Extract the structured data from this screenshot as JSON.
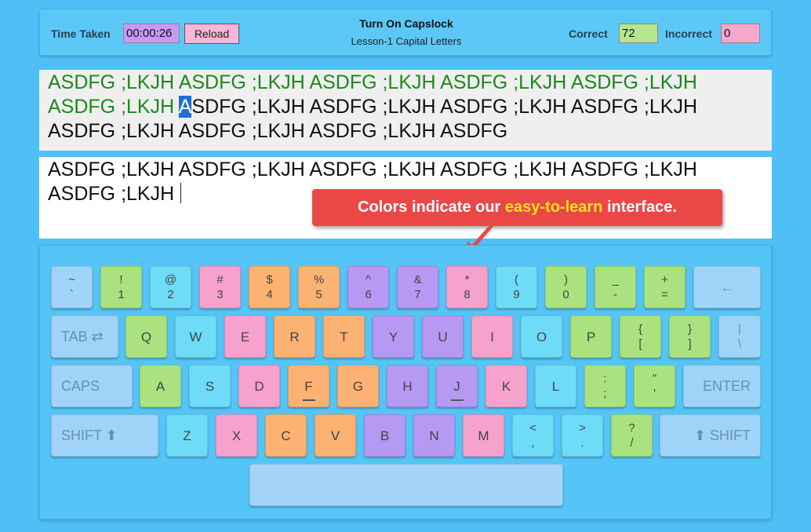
{
  "header": {
    "time_label": "Time Taken",
    "time_value": "00:00:26",
    "reload_label": "Reload",
    "title": "Turn On Capslock",
    "subtitle": "Lesson-1 Capital Letters",
    "correct_label": "Correct",
    "correct_value": "72",
    "incorrect_label": "Incorrect",
    "incorrect_value": "0"
  },
  "target": {
    "done_line1": "ASDFG ;LKJH ASDFG ;LKJH ASDFG ;LKJH ASDFG ;LKJH ASDFG ;LKJH",
    "done_line2": "ASDFG ;LKJH ",
    "current_char": "A",
    "rest_line2": "SDFG ;LKJH ASDFG ;LKJH ASDFG ;LKJH ASDFG ;LKJH",
    "line3": "ASDFG ;LKJH ASDFG ;LKJH ASDFG ;LKJH ASDFG"
  },
  "typed": {
    "line1": "ASDFG ;LKJH ASDFG ;LKJH ASDFG ;LKJH ASDFG ;LKJH ASDFG ;LKJH",
    "line2": "ASDFG ;LKJH"
  },
  "callout": {
    "pre": "Colors indicate our ",
    "highlight": "easy-to-learn",
    "post": " interface."
  },
  "colors": {
    "background": "#4fc0f5",
    "done_text": "#1a8a1a",
    "cursor": "#1d6fd6",
    "callout": "#ec4747",
    "callout_highlight": "#ffe21e"
  },
  "keys": {
    "row1": [
      {
        "top": "~",
        "bot": "`"
      },
      {
        "top": "!",
        "bot": "1"
      },
      {
        "top": "@",
        "bot": "2"
      },
      {
        "top": "#",
        "bot": "3"
      },
      {
        "top": "$",
        "bot": "4"
      },
      {
        "top": "%",
        "bot": "5"
      },
      {
        "top": "^",
        "bot": "6"
      },
      {
        "top": "&",
        "bot": "7"
      },
      {
        "top": "*",
        "bot": "8"
      },
      {
        "top": "(",
        "bot": "9"
      },
      {
        "top": ")",
        "bot": "0"
      },
      {
        "top": "_",
        "bot": "-"
      },
      {
        "top": "+",
        "bot": "="
      },
      {
        "label": "←",
        "icon": "backspace-icon"
      }
    ],
    "row2": [
      {
        "label": "TAB ⇄",
        "icon": "tab-icon"
      },
      {
        "label": "Q"
      },
      {
        "label": "W"
      },
      {
        "label": "E"
      },
      {
        "label": "R"
      },
      {
        "label": "T"
      },
      {
        "label": "Y"
      },
      {
        "label": "U"
      },
      {
        "label": "I"
      },
      {
        "label": "O"
      },
      {
        "label": "P"
      },
      {
        "top": "{",
        "bot": "["
      },
      {
        "top": "}",
        "bot": "]"
      },
      {
        "top": "|",
        "bot": "\\"
      }
    ],
    "row3": [
      {
        "label": "CAPS"
      },
      {
        "label": "A"
      },
      {
        "label": "S"
      },
      {
        "label": "D"
      },
      {
        "label": "F"
      },
      {
        "label": "G"
      },
      {
        "label": "H"
      },
      {
        "label": "J"
      },
      {
        "label": "K"
      },
      {
        "label": "L"
      },
      {
        "top": ":",
        "bot": ";"
      },
      {
        "top": "\"",
        "bot": "'"
      },
      {
        "label": "ENTER"
      }
    ],
    "row4": [
      {
        "label": "SHIFT ⬆"
      },
      {
        "label": "Z"
      },
      {
        "label": "X"
      },
      {
        "label": "C"
      },
      {
        "label": "V"
      },
      {
        "label": "B"
      },
      {
        "label": "N"
      },
      {
        "label": "M"
      },
      {
        "top": "<",
        "bot": ","
      },
      {
        "top": ">",
        "bot": "."
      },
      {
        "top": "?",
        "bot": "/"
      },
      {
        "label": "⬆ SHIFT"
      }
    ]
  }
}
